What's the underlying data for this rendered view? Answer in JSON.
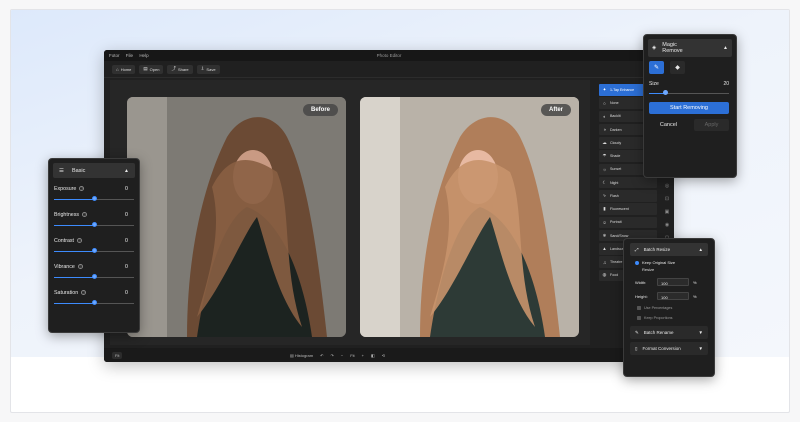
{
  "app": {
    "menu": [
      "Fotor",
      "File",
      "Help"
    ],
    "window_title": "Photo Editor",
    "toolbar": [
      {
        "icon": "home-icon",
        "glyph": "⌂",
        "label": "Home"
      },
      {
        "icon": "open-icon",
        "glyph": "▤",
        "label": "Open"
      },
      {
        "icon": "share-icon",
        "glyph": "⤴",
        "label": "Share"
      },
      {
        "icon": "save-icon",
        "glyph": "⇩",
        "label": "Save"
      }
    ]
  },
  "canvas": {
    "before_label": "Before",
    "after_label": "After"
  },
  "statusbar": {
    "zoom_preset": "Fit",
    "histogram_label": "Histogram",
    "zoom_value": "Fit"
  },
  "filters": [
    {
      "label": "1-Tap Enhance",
      "icon": "magic-icon",
      "glyph": "✦",
      "active": true
    },
    {
      "label": "None",
      "icon": "circle-icon",
      "glyph": "○"
    },
    {
      "label": "Backlit",
      "icon": "backlit-icon",
      "glyph": "◐"
    },
    {
      "label": "Darken",
      "icon": "darken-icon",
      "glyph": "◑"
    },
    {
      "label": "Cloudy",
      "icon": "cloud-icon",
      "glyph": "☁"
    },
    {
      "label": "Shade",
      "icon": "shade-icon",
      "glyph": "☂"
    },
    {
      "label": "Sunset",
      "icon": "sunset-icon",
      "glyph": "☼"
    },
    {
      "label": "Night",
      "icon": "moon-icon",
      "glyph": "☾"
    },
    {
      "label": "Flash",
      "icon": "flash-icon",
      "glyph": "ϟ"
    },
    {
      "label": "Fluorescent",
      "icon": "fluorescent-icon",
      "glyph": "▮"
    },
    {
      "label": "Portrait",
      "icon": "portrait-icon",
      "glyph": "☺"
    },
    {
      "label": "Sand/Snow",
      "icon": "snow-icon",
      "glyph": "❄"
    },
    {
      "label": "Landscape",
      "icon": "landscape-icon",
      "glyph": "▲"
    },
    {
      "label": "Theatre",
      "icon": "theatre-icon",
      "glyph": "♫"
    },
    {
      "label": "Food",
      "icon": "food-icon",
      "glyph": "◍"
    }
  ],
  "basic_panel": {
    "title": "Basic",
    "sliders": [
      {
        "label": "Exposure",
        "value": "0",
        "level": 0.5
      },
      {
        "label": "Brightness",
        "value": "0",
        "level": 0.5
      },
      {
        "label": "Contrast",
        "value": "0",
        "level": 0.5
      },
      {
        "label": "Vibrance",
        "value": "0",
        "level": 0.5
      },
      {
        "label": "Saturation",
        "value": "0",
        "level": 0.5
      }
    ]
  },
  "magic_panel": {
    "title_line1": "Magic",
    "title_line2": "Remove",
    "size_label": "Size",
    "size_value": "20",
    "size_level": 0.2,
    "start_label": "Start Removing",
    "cancel_label": "Cancel",
    "apply_label": "Apply"
  },
  "batch_panel": {
    "title": "Batch Resize",
    "keep_original": "Keep Original Size",
    "resize_label": "Resize",
    "width_label": "Width:",
    "width_value": "100",
    "height_label": "Height:",
    "height_value": "100",
    "unit": "%",
    "use_percentages": "Use Percentages",
    "keep_proportions": "Keep Proportions",
    "batch_rename": "Batch Rename",
    "format_conversion": "Format Conversion"
  },
  "colors": {
    "accent": "#2c6fd6",
    "app_bg": "#202020",
    "hero_bg": "#dde9fb"
  }
}
